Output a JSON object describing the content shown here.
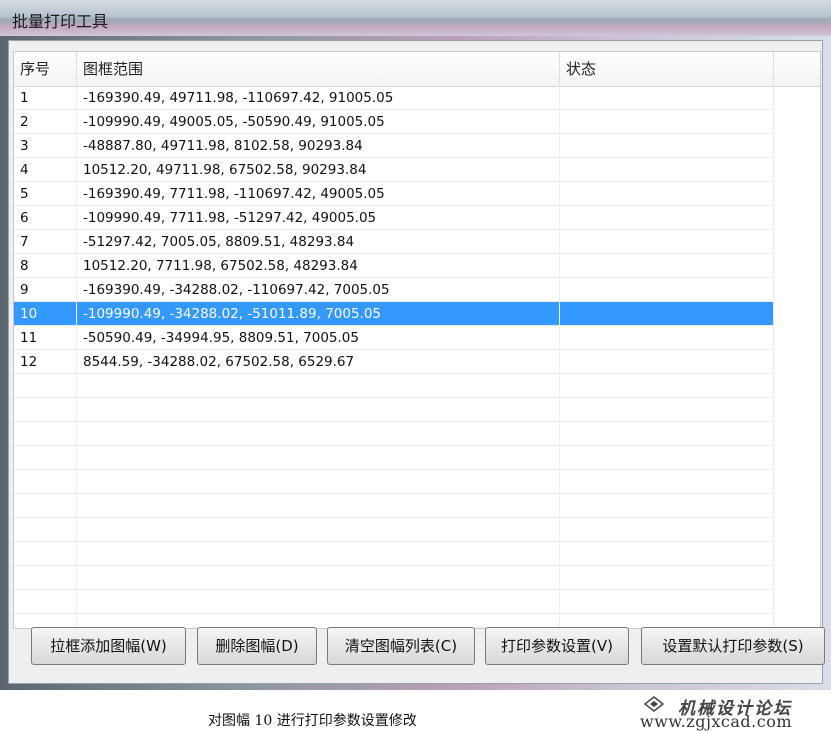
{
  "window": {
    "title": "批量打印工具"
  },
  "table": {
    "columns": [
      "序号",
      "图框范围",
      "状态",
      ""
    ],
    "rows": [
      {
        "no": "1",
        "range": "-169390.49, 49711.98, -110697.42, 91005.05",
        "status": ""
      },
      {
        "no": "2",
        "range": "-109990.49, 49005.05, -50590.49, 91005.05",
        "status": ""
      },
      {
        "no": "3",
        "range": "-48887.80, 49711.98, 8102.58, 90293.84",
        "status": ""
      },
      {
        "no": "4",
        "range": "10512.20, 49711.98, 67502.58, 90293.84",
        "status": ""
      },
      {
        "no": "5",
        "range": "-169390.49, 7711.98, -110697.42, 49005.05",
        "status": ""
      },
      {
        "no": "6",
        "range": "-109990.49, 7711.98, -51297.42, 49005.05",
        "status": ""
      },
      {
        "no": "7",
        "range": "-51297.42, 7005.05, 8809.51, 48293.84",
        "status": ""
      },
      {
        "no": "8",
        "range": "10512.20, 7711.98, 67502.58, 48293.84",
        "status": ""
      },
      {
        "no": "9",
        "range": "-169390.49, -34288.02, -110697.42, 7005.05",
        "status": ""
      },
      {
        "no": "10",
        "range": "-109990.49, -34288.02, -51011.89, 7005.05",
        "status": "",
        "selected": true
      },
      {
        "no": "11",
        "range": "-50590.49, -34994.95, 8809.51, 7005.05",
        "status": ""
      },
      {
        "no": "12",
        "range": "8544.59, -34288.02, 67502.58, 6529.67",
        "status": ""
      }
    ]
  },
  "buttons": {
    "add_by_window": "拉框添加图幅(W)",
    "delete": "删除图幅(D)",
    "clear_list": "清空图幅列表(C)",
    "print_settings": "打印参数设置(V)",
    "set_default": "设置默认打印参数(S)"
  },
  "caption": "对图幅 10 进行打印参数设置修改",
  "watermark": {
    "line1": "机械设计论坛",
    "line2": "www.zgjxcad.com"
  },
  "colors": {
    "selection": "#3399ff",
    "title_gradient_accent": "#c4a9c1"
  }
}
